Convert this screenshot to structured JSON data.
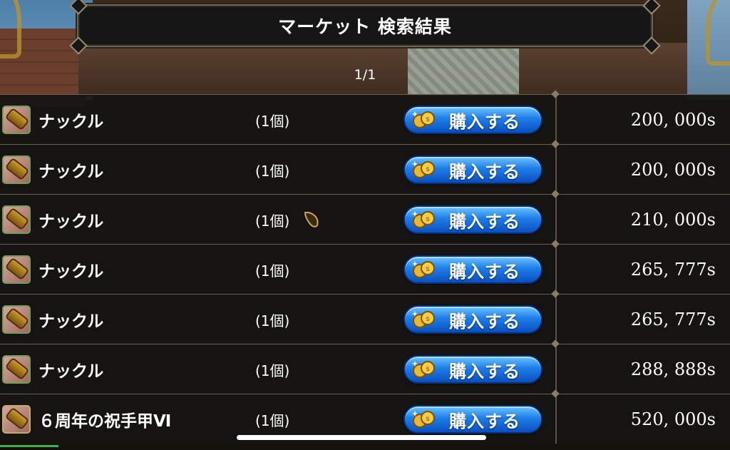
{
  "header": {
    "title": "マーケット 検索結果",
    "page_indicator": "1/1"
  },
  "buy_button_label": "購入する",
  "colors": {
    "buy_button": "#1f7ee8",
    "title_bar_bg": "#161616",
    "row_bg": "#161412"
  },
  "icons": {
    "item": "knuckle-icon",
    "buy": "coin-icon",
    "note": "seed-icon"
  },
  "listings": [
    {
      "name": "ナックル",
      "quantity": "(1個)",
      "price": "200, 000s",
      "has_note": false
    },
    {
      "name": "ナックル",
      "quantity": "(1個)",
      "price": "200, 000s",
      "has_note": false
    },
    {
      "name": "ナックル",
      "quantity": "(1個)",
      "price": "210, 000s",
      "has_note": true
    },
    {
      "name": "ナックル",
      "quantity": "(1個)",
      "price": "265, 777s",
      "has_note": false
    },
    {
      "name": "ナックル",
      "quantity": "(1個)",
      "price": "265, 777s",
      "has_note": false
    },
    {
      "name": "ナックル",
      "quantity": "(1個)",
      "price": "288, 888s",
      "has_note": false
    },
    {
      "name": "６周年の祝手甲Ⅵ",
      "quantity": "(1個)",
      "price": "520, 000s",
      "has_note": false
    }
  ]
}
